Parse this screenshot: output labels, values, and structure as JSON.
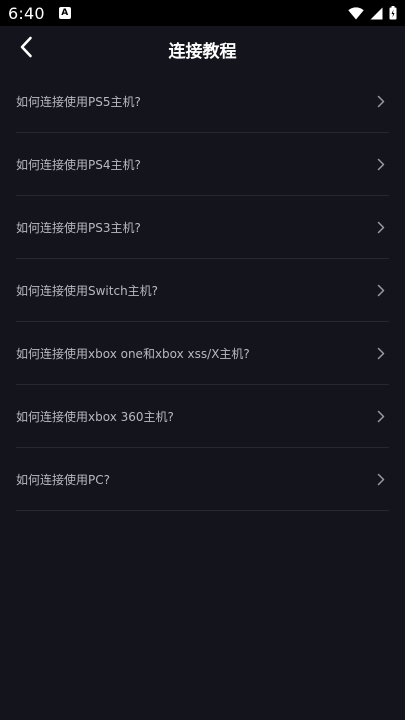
{
  "status_bar": {
    "time": "6:40",
    "notification_glyph": "A"
  },
  "header": {
    "title": "连接教程",
    "back_icon": "chevron-left-icon"
  },
  "tutorials": {
    "items": [
      {
        "label": "如何连接使用PS5主机?"
      },
      {
        "label": "如何连接使用PS4主机?"
      },
      {
        "label": "如何连接使用PS3主机?"
      },
      {
        "label": "如何连接使用Switch主机?"
      },
      {
        "label": "如何连接使用xbox one和xbox xss/X主机?"
      },
      {
        "label": "如何连接使用xbox 360主机?"
      },
      {
        "label": "如何连接使用PC?"
      }
    ],
    "item_icon": "chevron-right-icon"
  },
  "colors": {
    "background": "#14141c",
    "divider": "#272731",
    "item_text": "#b8b8c0",
    "chevron": "#9a9aa2"
  }
}
